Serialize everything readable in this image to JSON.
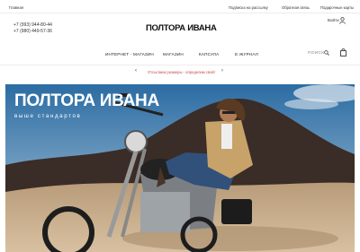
{
  "topbar": {
    "home": "Главная",
    "subscribe": "Подписка на рассылку",
    "feedback": "Обратная связь",
    "giftcards": "Подарочные карты"
  },
  "phones": [
    "+7 (993) 944-80-44",
    "+7 (980) 449-57-36"
  ],
  "logo": {
    "text": "ПОЛТОРА ИВАНА"
  },
  "account": {
    "login": "Войти"
  },
  "nav": {
    "items": [
      "ИНТЕРНЕТ - МАГАЗИН",
      "МАГАЗИН",
      "КАПСУЛА",
      "E-ЖУРНАЛ"
    ],
    "search_label": "ПОИСК"
  },
  "promo": {
    "text": "Отсылаем размеры - определим свой!",
    "prev": "‹",
    "next": "›"
  },
  "hero": {
    "title": "ПОЛТОРА ИВАНА",
    "subtitle": "выше стандартов"
  },
  "colors": {
    "promo_text": "#c94a4a",
    "sky_top": "#2b6ca3",
    "desert": "#c7a882"
  }
}
